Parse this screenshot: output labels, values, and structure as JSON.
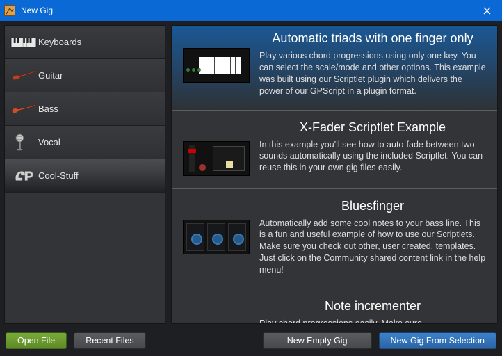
{
  "window": {
    "title": "New Gig"
  },
  "sidebar": {
    "items": [
      {
        "label": "Keyboards"
      },
      {
        "label": "Guitar"
      },
      {
        "label": "Bass"
      },
      {
        "label": "Vocal"
      },
      {
        "label": "Cool-Stuff"
      }
    ],
    "selected_index": 4
  },
  "entries": [
    {
      "title": "Automatic triads with one finger only",
      "desc": "Play various chord progressions using only one key. You can select the scale/mode and other options. This example was built using our Scriptlet plugin which delivers the power of our GPScript in a plugin format."
    },
    {
      "title": "X-Fader Scriptlet Example",
      "desc": "In this example you'll see how to auto-fade between two sounds automatically using the included Scriptlet. You can reuse this in your own gig files easily."
    },
    {
      "title": "Bluesfinger",
      "desc": "Automatically add some cool notes to your bass line. This is a fun and useful example of how to use our Scriptlets. Make sure you check out other, user created, templates. Just click on the Community shared content link in the help menu!"
    },
    {
      "title": "Note incrementer",
      "desc": "Play chord progressions easily. Make sure"
    }
  ],
  "buttons": {
    "open_file": "Open File",
    "recent_files": "Recent Files",
    "new_empty_gig": "New Empty Gig",
    "new_from_selection": "New Gig From Selection"
  }
}
